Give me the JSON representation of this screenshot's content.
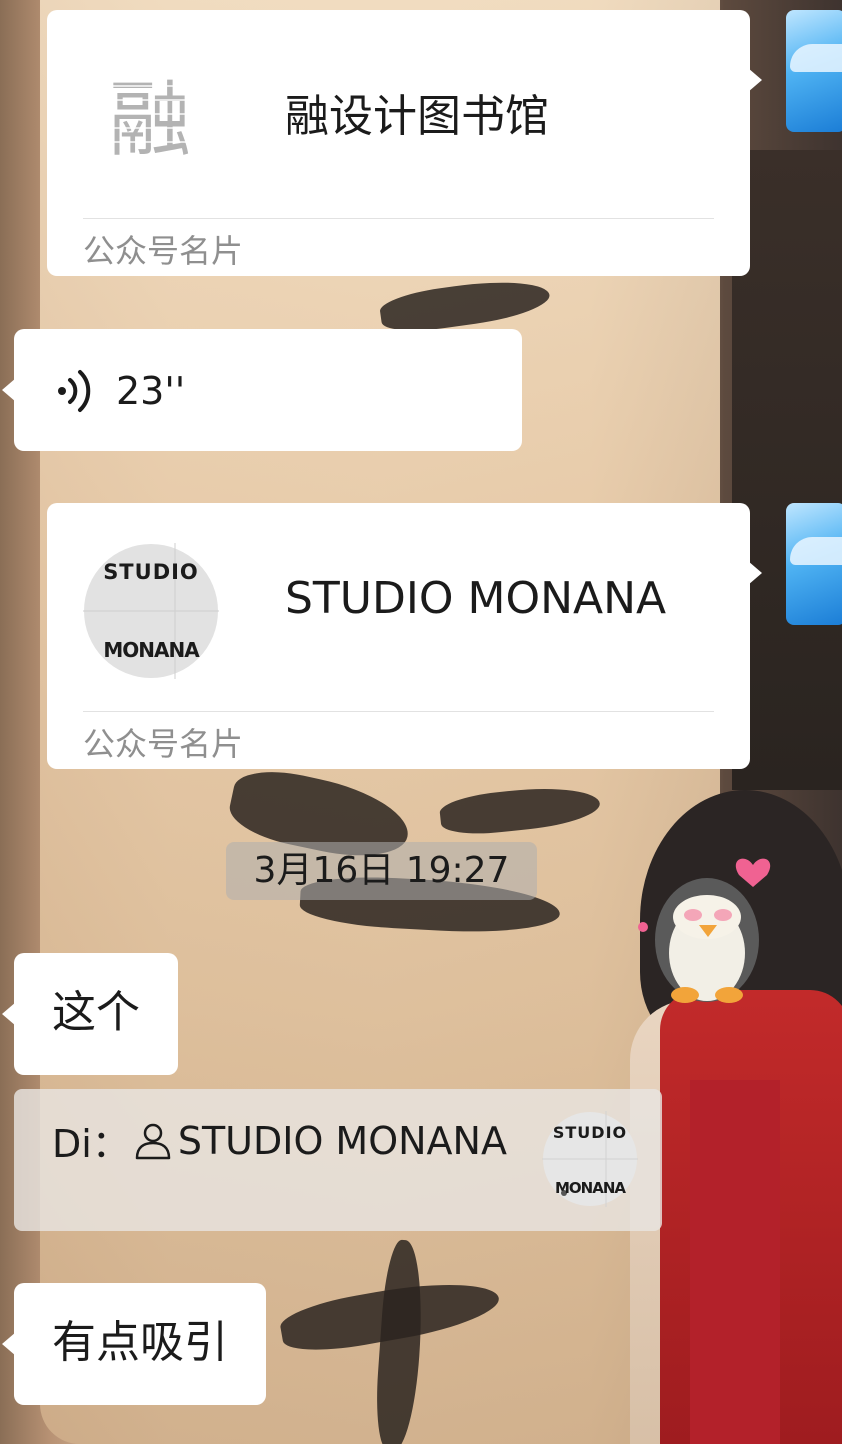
{
  "messages": {
    "card1": {
      "name": "融设计图书馆",
      "logo_text": "融",
      "type_label": "公众号名片"
    },
    "voice": {
      "duration": "23''"
    },
    "card2": {
      "name": "STUDIO MONANA",
      "logo_top": "STUDIO",
      "logo_bottom": "MONANA",
      "type_label": "公众号名片"
    },
    "timestamp": "3月16日 19:27",
    "text1": "这个",
    "quote": {
      "sender": "Di：",
      "content": "STUDIO MONANA",
      "logo_top": "STUDIO",
      "logo_bottom": "MONANA"
    },
    "text2": "有点吸引"
  },
  "icons": {
    "voice": "voice-wave-icon",
    "person": "person-icon",
    "avatar": "whale-avatar"
  },
  "colors": {
    "bubble": "#ffffff",
    "text": "#1b1b1b",
    "muted": "#8f8f8f"
  }
}
